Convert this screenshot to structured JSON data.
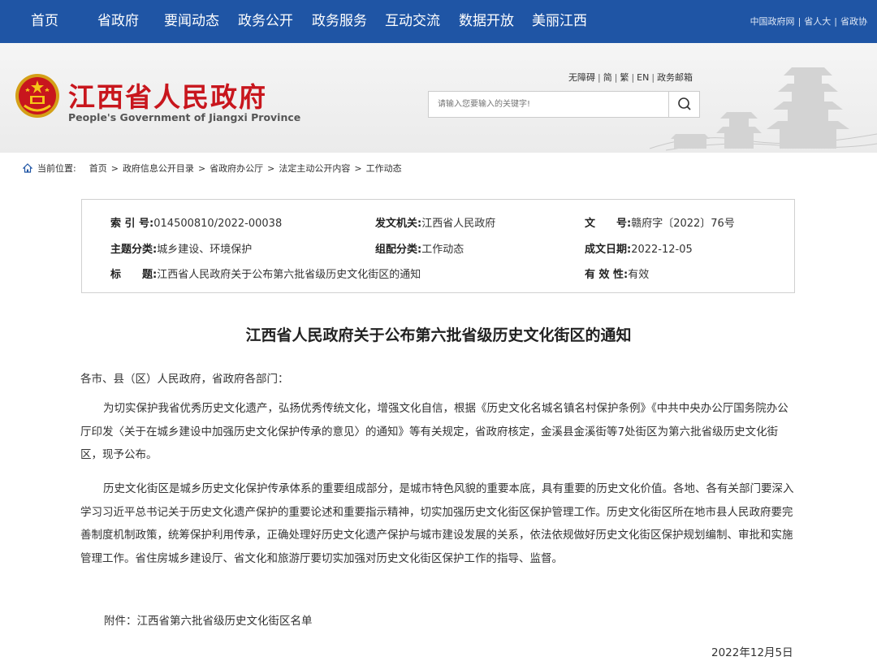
{
  "nav": {
    "items": [
      "首页",
      "省政府",
      "要闻动态",
      "政务公开",
      "政务服务",
      "互动交流",
      "数据开放",
      "美丽江西"
    ],
    "right_links": [
      "中国政府网",
      "省人大",
      "省政协"
    ]
  },
  "header": {
    "site_title": "江西省人民政府",
    "site_subtitle": "People's Government of Jiangxi Province",
    "util_links": [
      "无障碍",
      "简",
      "繁",
      "EN",
      "政务邮箱"
    ],
    "search_placeholder": "请输入您要输入的关键字!"
  },
  "breadcrumb": {
    "label": "当前位置:",
    "items": [
      "首页",
      "政府信息公开目录",
      "省政府办公厅",
      "法定主动公开内容",
      "工作动态"
    ],
    "separator": ">"
  },
  "info": {
    "index_label": "索 引 号:",
    "index_value": "014500810/2022-00038",
    "issuer_label": "发文机关:",
    "issuer_value": "江西省人民政府",
    "docno_label": "文　　号:",
    "docno_value": "赣府字〔2022〕76号",
    "topic_label": "主题分类:",
    "topic_value": "城乡建设、环境保护",
    "group_label": "组配分类:",
    "group_value": "工作动态",
    "date_label": "成文日期:",
    "date_value": "2022-12-05",
    "title_label": "标　　题:",
    "title_value": "江西省人民政府关于公布第六批省级历史文化街区的通知",
    "validity_label": "有 效 性:",
    "validity_value": "有效"
  },
  "article": {
    "title": "江西省人民政府关于公布第六批省级历史文化街区的通知",
    "salutation": "各市、县（区）人民政府，省政府各部门：",
    "para1": "为切实保护我省优秀历史文化遗产，弘扬优秀传统文化，增强文化自信，根据《历史文化名城名镇名村保护条例》《中共中央办公厅国务院办公厅印发〈关于在城乡建设中加强历史文化保护传承的意见〉的通知》等有关规定，省政府核定，金溪县金溪街等7处街区为第六批省级历史文化街区，现予公布。",
    "para2": "历史文化街区是城乡历史文化保护传承体系的重要组成部分，是城市特色风貌的重要本底，具有重要的历史文化价值。各地、各有关部门要深入学习习近平总书记关于历史文化遗产保护的重要论述和重要指示精神，切实加强历史文化街区保护管理工作。历史文化街区所在地市县人民政府要完善制度机制政策，统筹保护利用传承，正确处理好历史文化遗产保护与城市建设发展的关系，依法依规做好历史文化街区保护规划编制、审批和实施管理工作。省住房城乡建设厅、省文化和旅游厅要切实加强对历史文化街区保护工作的指导、监督。",
    "attachment": "附件：江西省第六批省级历史文化街区名单",
    "date": "2022年12月5日"
  },
  "colors": {
    "nav_bg": "#1f55a5",
    "title_red": "#c8161d"
  }
}
